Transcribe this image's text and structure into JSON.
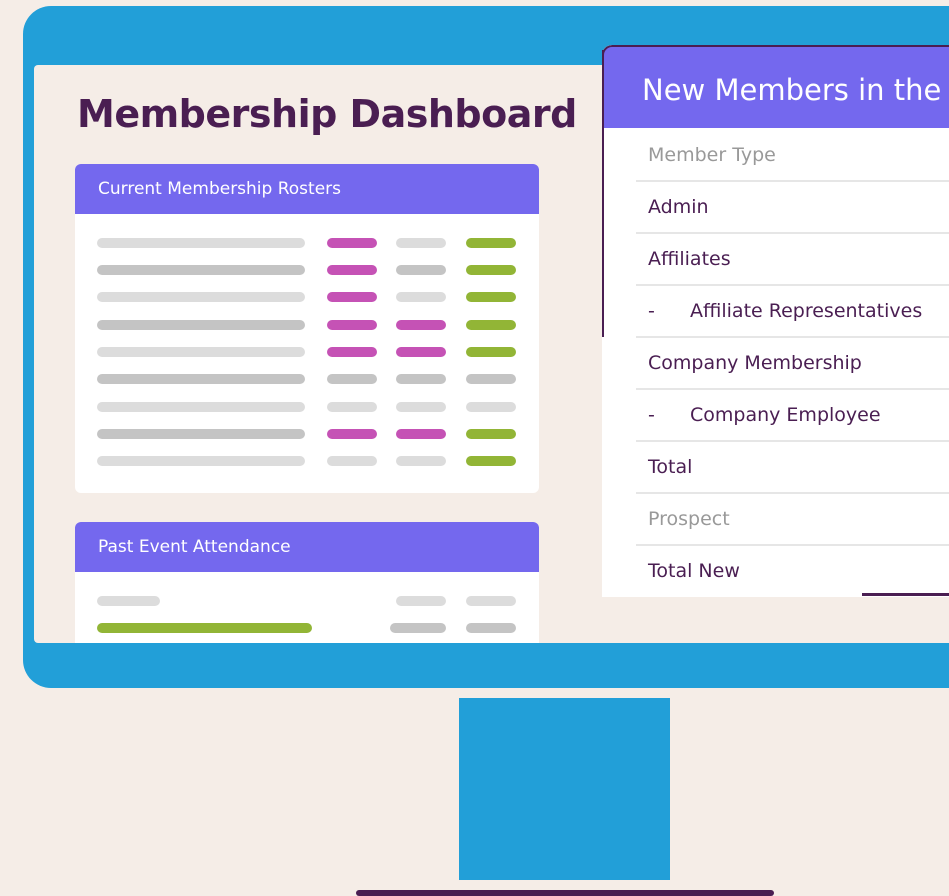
{
  "dashboard": {
    "title": "Membership Dashboard",
    "roster_card": {
      "title": "Current Membership Rosters"
    },
    "events_card": {
      "title": "Past Event Attendance"
    }
  },
  "new_members_panel": {
    "title": "New Members in the",
    "rows": [
      {
        "label": "Member Type",
        "prefix": "",
        "muted": true
      },
      {
        "label": "Admin",
        "prefix": "",
        "muted": false
      },
      {
        "label": "Affiliates",
        "prefix": "",
        "muted": false
      },
      {
        "label": "Affiliate Representatives",
        "prefix": "-",
        "muted": false
      },
      {
        "label": "Company Membership",
        "prefix": "",
        "muted": false
      },
      {
        "label": "Company Employee",
        "prefix": "-",
        "muted": false
      },
      {
        "label": "Total",
        "prefix": "",
        "muted": false
      },
      {
        "label": "Prospect",
        "prefix": "",
        "muted": true
      },
      {
        "label": "Total New",
        "prefix": "",
        "muted": false
      }
    ]
  },
  "colors": {
    "monitor": "#229fd8",
    "screen_bg": "#f5ede7",
    "header_purple": "#7468ee",
    "text_dark": "#4a1e52",
    "bar_magenta": "#c552b5",
    "bar_green": "#92b536",
    "bar_gray_light": "#dcdcdc",
    "bar_gray": "#c4c4c4"
  }
}
